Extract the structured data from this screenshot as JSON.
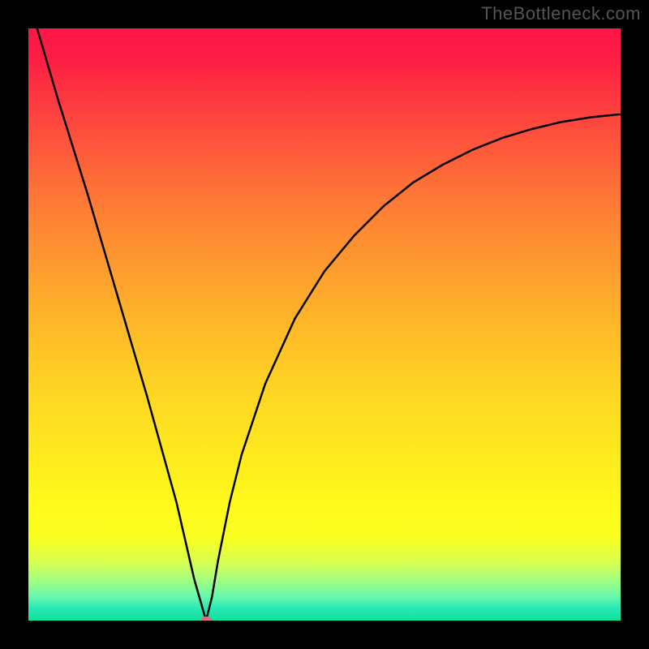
{
  "watermark": "TheBottleneck.com",
  "colors": {
    "page_bg": "#000000",
    "curve": "#000000",
    "marker": "#d6707a",
    "gradient_top": "#fd1546",
    "gradient_bottom": "#0ee19a"
  },
  "chart_data": {
    "type": "line",
    "title": "",
    "xlabel": "",
    "ylabel": "",
    "xlim": [
      0,
      100
    ],
    "ylim": [
      0,
      100
    ],
    "grid": false,
    "legend": false,
    "series": [
      {
        "name": "bottleneck-curve",
        "x": [
          0,
          5,
          10,
          15,
          20,
          25,
          28,
          30,
          31,
          32,
          34,
          36,
          40,
          45,
          50,
          55,
          60,
          65,
          70,
          75,
          80,
          85,
          90,
          95,
          100
        ],
        "values": [
          105,
          88,
          72,
          55,
          38,
          20,
          7,
          0,
          4,
          10,
          20,
          28,
          40,
          51,
          59,
          65,
          70,
          74,
          77,
          79.5,
          81.5,
          83,
          84.2,
          85,
          85.5
        ]
      }
    ],
    "annotations": [
      {
        "name": "optimum-marker",
        "x": 30,
        "y": 0
      }
    ]
  }
}
